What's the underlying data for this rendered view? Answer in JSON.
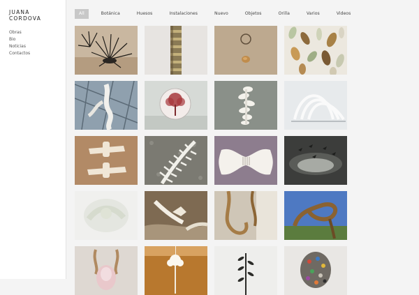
{
  "brand": {
    "line1": "JUANA",
    "line2": "CORDOVA"
  },
  "nav": [
    {
      "label": "Obras"
    },
    {
      "label": "Bio"
    },
    {
      "label": "Noticias"
    },
    {
      "label": "Contactos"
    }
  ],
  "filters": [
    {
      "label": "All",
      "active": true
    },
    {
      "label": "Botánica"
    },
    {
      "label": "Huesos"
    },
    {
      "label": "Instalaciones"
    },
    {
      "label": "Nuevo"
    },
    {
      "label": "Objetos"
    },
    {
      "label": "Orilla"
    },
    {
      "label": "Varios"
    },
    {
      "label": "Videos"
    }
  ],
  "thumbnails": [
    {
      "icon": "spiky-plants-photo"
    },
    {
      "icon": "stacked-column-photo"
    },
    {
      "icon": "ring-and-disc-photo"
    },
    {
      "icon": "leaf-collection-photo"
    },
    {
      "icon": "white-sculpture-glass-ceiling-photo"
    },
    {
      "icon": "red-tree-disc-photo"
    },
    {
      "icon": "twisted-white-sculpture-photo"
    },
    {
      "icon": "white-ribcage-arches-photo"
    },
    {
      "icon": "vertebrae-pair-photo"
    },
    {
      "icon": "spine-on-stone-photo"
    },
    {
      "icon": "bone-axe-photo"
    },
    {
      "icon": "bird-landscape-photo"
    },
    {
      "icon": "faded-bone-photo"
    },
    {
      "icon": "bone-on-sand-photo"
    },
    {
      "icon": "hanging-rope-gallery-photo"
    },
    {
      "icon": "twisted-trunk-sky-photo"
    },
    {
      "icon": "pink-figure-photo"
    },
    {
      "icon": "hanging-white-tree-photo"
    },
    {
      "icon": "dark-plant-photo"
    },
    {
      "icon": "beaded-skull-photo"
    }
  ]
}
